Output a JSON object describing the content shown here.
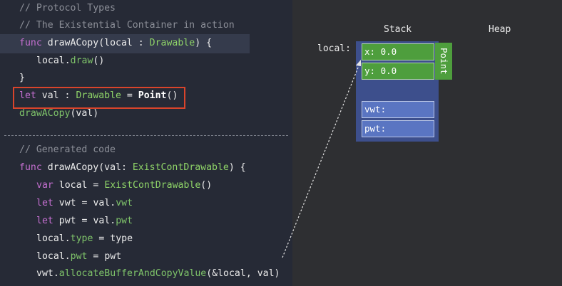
{
  "code": {
    "lines": [
      "// Protocol Types",
      "// The Existential Container in action",
      "func drawACopy(local : Drawable) {",
      "local.draw()",
      "}",
      "let val : Drawable = Point()",
      "drawACopy(val)",
      "// Generated code",
      "func drawACopy(val: ExistContDrawable) {",
      "var local = ExistContDrawable()",
      "let vwt = val.vwt",
      "let pwt = val.pwt",
      "local.type = type",
      "local.pwt = pwt",
      "vwt.allocateBufferAndCopyValue(&local, val)"
    ],
    "tokens": {
      "func": "func",
      "let": "let",
      "var": "var",
      "drawACopy": "drawACopy",
      "local": "local",
      "Drawable": "Drawable",
      "draw": "draw",
      "val": "val",
      "Point": "Point",
      "ExistContDrawable": "ExistContDrawable",
      "vwt": "vwt",
      "pwt": "pwt",
      "type": "type",
      "allocateBufferAndCopyValue": "allocateBufferAndCopyValue"
    }
  },
  "diagram": {
    "stack_title": "Stack",
    "heap_title": "Heap",
    "local_label": "local:",
    "cells": [
      "x: 0.0",
      "y: 0.0",
      "",
      "vwt:",
      "pwt:"
    ],
    "point_label": "Point"
  },
  "colors": {
    "code_bg": "#262a36",
    "keyword": "#c46fd0",
    "type": "#8fd468",
    "comment": "#8c8f98",
    "highlight_box": "#d9442b",
    "cell_green": "#4e9e3d",
    "cell_blue": "#5a75c2"
  }
}
